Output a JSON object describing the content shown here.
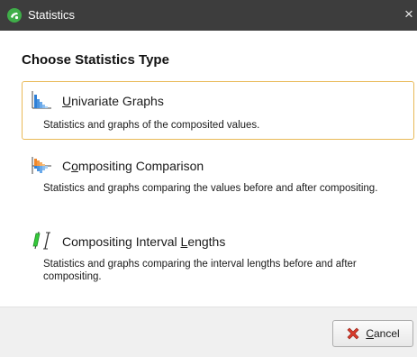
{
  "window": {
    "title": "Statistics",
    "close_glyph": "×",
    "app_icon": "leapfrog-app-icon"
  },
  "heading": "Choose Statistics Type",
  "options": [
    {
      "title_accel": "U",
      "title_rest": "nivariate Graphs",
      "description": "Statistics and graphs of the composited values.",
      "icon": "histogram-icon",
      "selected": true
    },
    {
      "title_pre": "C",
      "title_accel": "o",
      "title_rest": "mpositing Comparison",
      "description": "Statistics and graphs comparing the values before and after compositing.",
      "icon": "comparison-histogram-icon",
      "selected": false
    },
    {
      "title_pre": "Compositing Interval ",
      "title_accel": "L",
      "title_rest": "engths",
      "description": "Statistics and graphs comparing the interval lengths before and after compositing.",
      "icon": "interval-lengths-icon",
      "selected": false
    }
  ],
  "footer": {
    "cancel_accel": "C",
    "cancel_rest": "ancel",
    "cancel_icon": "cancel-x-icon"
  },
  "colors": {
    "titlebar": "#3d3d3d",
    "selection_border": "#e9b957",
    "histogram_blue": "#2e7fd6",
    "compare_orange": "#f0872a",
    "interval_green": "#35c93a"
  }
}
